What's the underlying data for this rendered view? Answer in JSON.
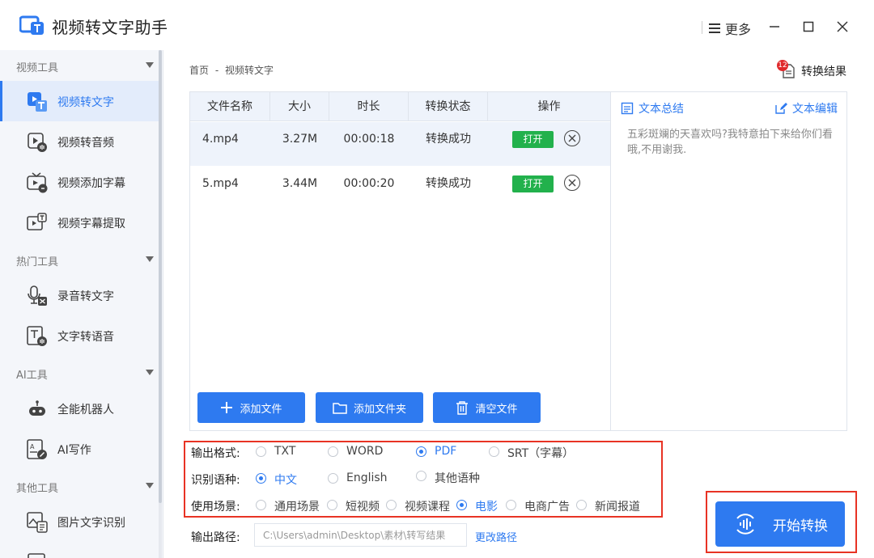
{
  "app": {
    "title": "视频转文字助手",
    "more_label": "更多"
  },
  "sidebar": {
    "groups": [
      {
        "label": "视频工具",
        "items": [
          {
            "label": "视频转文字",
            "icon": "video-to-text-icon",
            "active": true
          },
          {
            "label": "视频转音频",
            "icon": "video-to-audio-icon"
          },
          {
            "label": "视频添加字幕",
            "icon": "video-subtitle-add-icon"
          },
          {
            "label": "视频字幕提取",
            "icon": "subtitle-extract-icon"
          }
        ]
      },
      {
        "label": "热门工具",
        "items": [
          {
            "label": "录音转文字",
            "icon": "mic-to-text-icon"
          },
          {
            "label": "文字转语音",
            "icon": "text-to-speech-icon"
          }
        ]
      },
      {
        "label": "AI工具",
        "items": [
          {
            "label": "全能机器人",
            "icon": "robot-icon"
          },
          {
            "label": "AI写作",
            "icon": "ai-writing-icon"
          }
        ]
      },
      {
        "label": "其他工具",
        "items": [
          {
            "label": "图片文字识别",
            "icon": "image-ocr-icon"
          }
        ]
      }
    ]
  },
  "breadcrumb": {
    "home": "首页",
    "sep": "-",
    "current": "视频转文字"
  },
  "results": {
    "label": "转换结果",
    "badge": "12"
  },
  "table": {
    "headers": [
      "文件名称",
      "大小",
      "时长",
      "转换状态",
      "操作"
    ],
    "rows": [
      {
        "name": "4.mp4",
        "size": "3.27M",
        "duration": "00:00:18",
        "status": "转换成功",
        "open": "打开"
      },
      {
        "name": "5.mp4",
        "size": "3.44M",
        "duration": "00:00:20",
        "status": "转换成功",
        "open": "打开"
      }
    ]
  },
  "actions": {
    "add_file": "添加文件",
    "add_folder": "添加文件夹",
    "clear": "清空文件"
  },
  "text_panel": {
    "summary_label": "文本总结",
    "edit_label": "文本编辑",
    "content": "五彩斑斓的天喜欢吗?我特意拍下来给你们看哦,不用谢我."
  },
  "options": {
    "format": {
      "label": "输出格式:",
      "choices": [
        "TXT",
        "WORD",
        "PDF",
        "SRT（字幕）"
      ],
      "selected": "PDF"
    },
    "language": {
      "label": "识别语种:",
      "choices": [
        "中文",
        "English",
        "其他语种"
      ],
      "selected": "中文"
    },
    "scene": {
      "label": "使用场景:",
      "choices": [
        "通用场景",
        "短视频",
        "视频课程",
        "电影",
        "电商广告",
        "新闻报道"
      ],
      "selected": "电影"
    }
  },
  "output": {
    "label": "输出路径:",
    "value": "C:\\Users\\admin\\Desktop\\素材\\转写结果",
    "change_label": "更改路径"
  },
  "start": {
    "label": "开始转换"
  },
  "colors": {
    "accent": "#2e7af0",
    "success": "#22b14c",
    "highlight": "#e83324",
    "badge": "#e0292b"
  }
}
